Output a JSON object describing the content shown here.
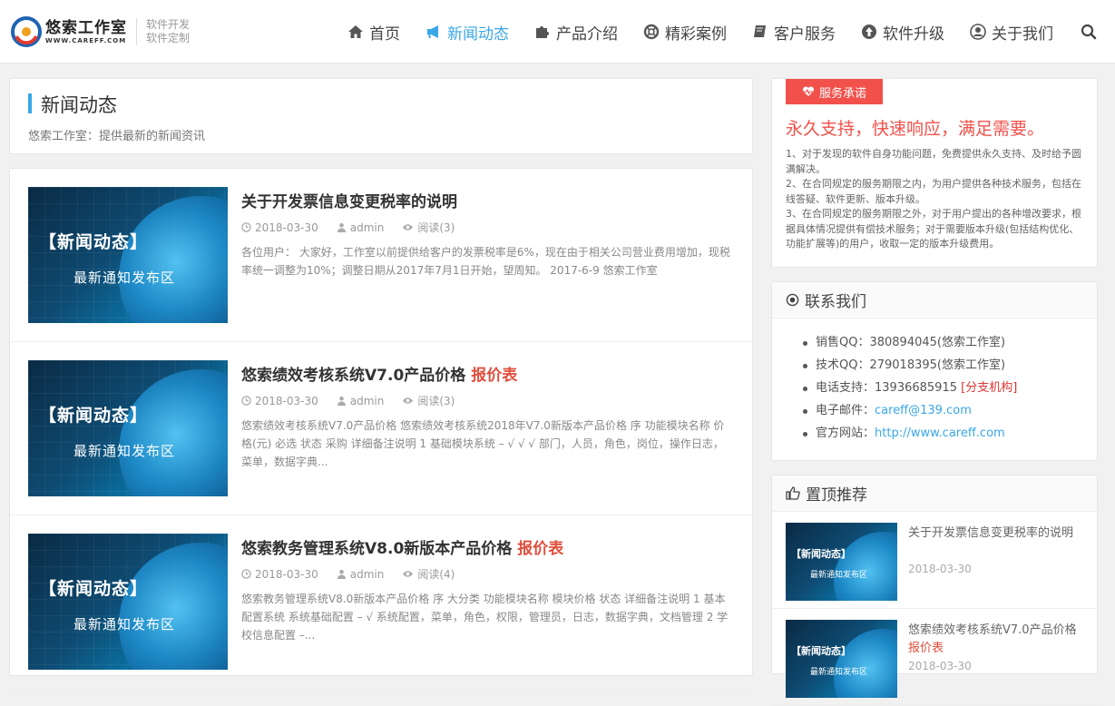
{
  "logo": {
    "name": "悠索工作室",
    "url": "WWW.CAREFF.COM",
    "slogan1": "软件开发",
    "slogan2": "软件定制"
  },
  "nav": [
    {
      "label": "首页",
      "icon": "home-icon"
    },
    {
      "label": "新闻动态",
      "icon": "bullhorn-icon",
      "active": true
    },
    {
      "label": "产品介绍",
      "icon": "puzzle-icon"
    },
    {
      "label": "精彩案例",
      "icon": "life-ring-icon"
    },
    {
      "label": "客户服务",
      "icon": "book-icon"
    },
    {
      "label": "软件升级",
      "icon": "arrow-up-circle-icon"
    },
    {
      "label": "关于我们",
      "icon": "user-circle-icon"
    }
  ],
  "page": {
    "title": "新闻动态",
    "subtitle": "悠索工作室：提供最新的新闻资讯"
  },
  "thumb": {
    "line1": "【新闻动态】",
    "line2": "最新通知发布区"
  },
  "articles": [
    {
      "title": "关于开发票信息变更税率的说明",
      "highlight": "",
      "date": "2018-03-30",
      "author": "admin",
      "views": "阅读(3)",
      "excerpt": "各位用户： 大家好，工作室以前提供给客户的发票税率是6%，现在由于相关公司营业费用增加，现税率统一调整为10%；调整日期从2017年7月1日开始，望周知。 2017-6-9 悠索工作室"
    },
    {
      "title": "悠索绩效考核系统V7.0产品价格 ",
      "highlight": "报价表",
      "date": "2018-03-30",
      "author": "admin",
      "views": "阅读(3)",
      "excerpt": "悠索绩效考核系统V7.0产品价格 悠索绩效考核系统2018年V7.0新版本产品价格 序 功能模块名称 价格(元) 必选 状态 采购 详细备注说明 1 基础模块系统 – √ √ √ 部门，人员，角色，岗位，操作日志，菜单，数据字典..."
    },
    {
      "title": "悠索教务管理系统V8.0新版本产品价格 ",
      "highlight": "报价表",
      "date": "2018-03-30",
      "author": "admin",
      "views": "阅读(4)",
      "excerpt": "悠索教务管理系统V8.0新版本产品价格 序 大分类 功能模块名称 模块价格 状态 详细备注说明 1 基本配置系统 系统基础配置 – √ 系统配置，菜单，角色，权限，管理员，日志，数据字典，文档管理 2 学校信息配置 –..."
    }
  ],
  "promise": {
    "tag": "服务承诺",
    "headline": "永久支持，快速响应，满足需要。",
    "body": "1、对于发现的软件自身功能问题，免费提供永久支持、及时给予圆满解决。\n2、在合同规定的服务期限之内，为用户提供各种技术服务，包括在线答疑、软件更新、版本升级。\n3、在合同规定的服务期限之外，对于用户提出的各种增改要求，根据具体情况提供有偿技术服务；对于需要版本升级(包括结构优化、功能扩展等)的用户，收取一定的版本升级费用。"
  },
  "contact": {
    "title": "联系我们",
    "sales_label": "销售QQ：",
    "sales": "380894045(悠索工作室)",
    "tech_label": "技术QQ：",
    "tech": "279018395(悠索工作室)",
    "phone_label": "电话支持：",
    "phone": "13936685915 ",
    "branch": "[分支机构]",
    "email_label": "电子邮件：",
    "email": "careff@139.com",
    "site_label": "官方网站：",
    "site": "http://www.careff.com"
  },
  "recommend": {
    "title": "置顶推荐",
    "thumb_line1": "【新闻动态】",
    "thumb_line2": "最新通知发布区",
    "items": [
      {
        "title": "关于开发票信息变更税率的说明",
        "highlight": "",
        "date": "2018-03-30"
      },
      {
        "title": "悠索绩效考核系统V7.0产品价格 ",
        "highlight": "报价表",
        "date": "2018-03-30"
      }
    ]
  },
  "colors": {
    "accent": "#3aa7e8",
    "red": "#f2514b"
  }
}
